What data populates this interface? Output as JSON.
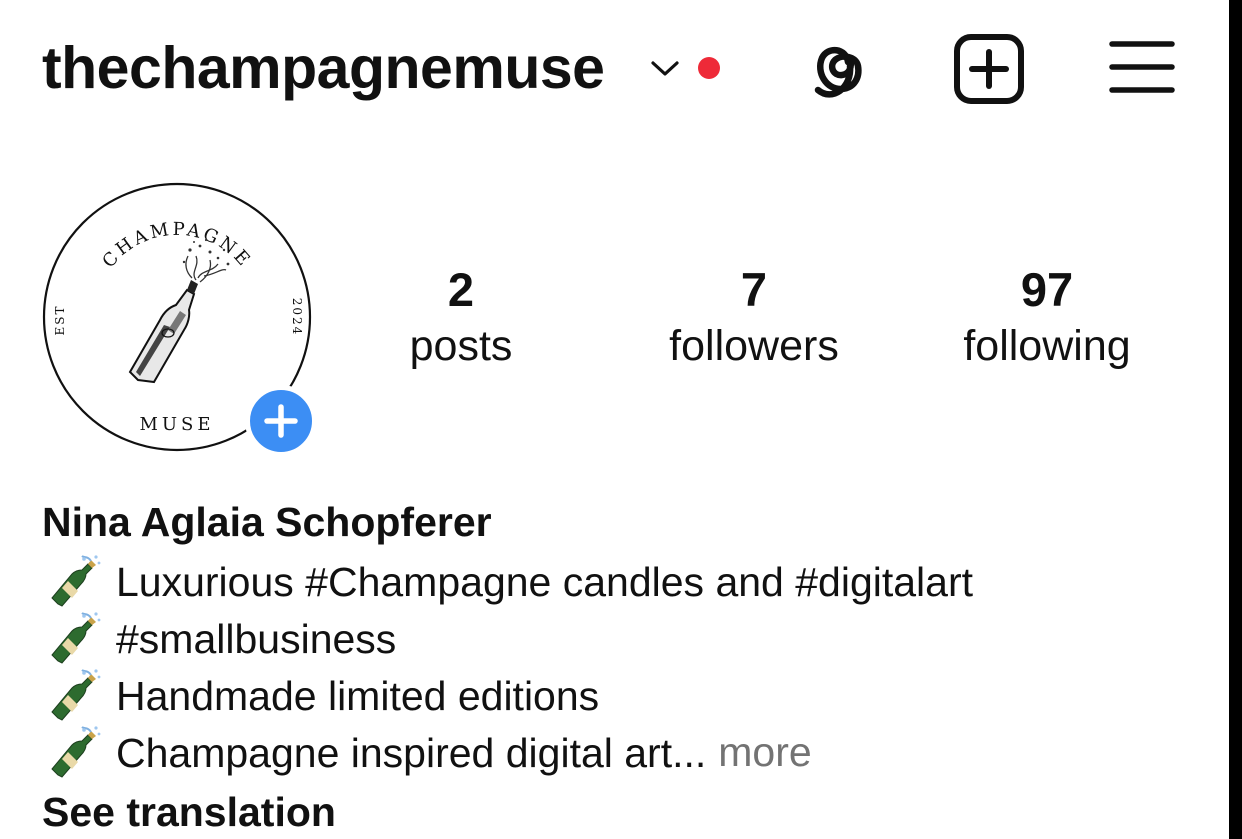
{
  "header": {
    "username": "thechampagnemuse",
    "notification_dot_color": "#ee2a38",
    "icons": [
      "chevron-down-icon",
      "threads-icon",
      "create-plus-icon",
      "hamburger-menu-icon"
    ]
  },
  "avatar": {
    "logo_top_text": "CHAMPAGNE",
    "logo_bottom_text": "MUSE",
    "logo_left_text": "EST",
    "logo_right_text": "2024",
    "add_story_color": "#3c8ef4"
  },
  "stats": [
    {
      "count": "2",
      "label": "posts"
    },
    {
      "count": "7",
      "label": "followers"
    },
    {
      "count": "97",
      "label": "following"
    }
  ],
  "profile": {
    "full_name": "Nina Aglaia Schopferer",
    "bio_lines": [
      "Luxurious #Champagne candles and #digitalart",
      "#smallbusiness",
      "Handmade limited editions",
      "Champagne inspired digital art..."
    ],
    "bio_emoji": "bottle-with-popping-cork-icon",
    "more_label": "more",
    "see_translation": "See translation"
  }
}
